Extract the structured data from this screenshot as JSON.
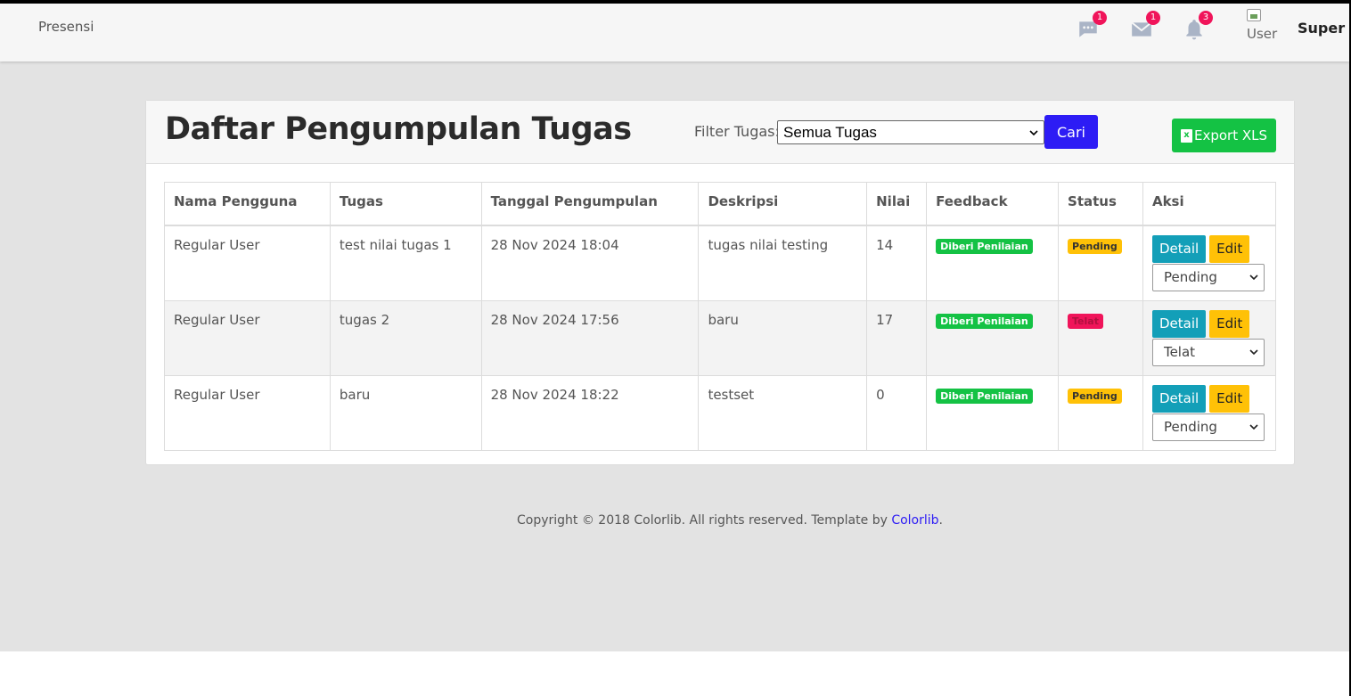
{
  "topbar": {
    "brand": "Presensi",
    "icons": [
      {
        "name": "chat-icon",
        "count": "1"
      },
      {
        "name": "mail-icon",
        "count": "1"
      },
      {
        "name": "bell-icon",
        "count": "3"
      }
    ],
    "avatar_alt": "User",
    "username": "Super A"
  },
  "card": {
    "title": "Daftar Pengumpulan Tugas",
    "filter_label": "Filter Tugas:",
    "filter_value": "Semua Tugas",
    "search_label": "Cari",
    "export_label": "Export XLS"
  },
  "table": {
    "headers": [
      "Nama Pengguna",
      "Tugas",
      "Tanggal Pengumpulan",
      "Deskripsi",
      "Nilai",
      "Feedback",
      "Status",
      "Aksi"
    ],
    "rows": [
      {
        "user": "Regular User",
        "task": "test nilai tugas 1",
        "date": "28 Nov 2024 18:04",
        "desc": "tugas nilai testing",
        "score": "14",
        "feedback": "Diberi Penilaian",
        "status": "Pending",
        "select": "Pending"
      },
      {
        "user": "Regular User",
        "task": "tugas 2",
        "date": "28 Nov 2024 17:56",
        "desc": "baru",
        "score": "17",
        "feedback": "Diberi Penilaian",
        "status": "Telat",
        "select": "Telat"
      },
      {
        "user": "Regular User",
        "task": "baru",
        "date": "28 Nov 2024 18:22",
        "desc": "testset",
        "score": "0",
        "feedback": "Diberi Penilaian",
        "status": "Pending",
        "select": "Pending"
      }
    ],
    "detail_label": "Detail",
    "edit_label": "Edit"
  },
  "footer": {
    "text": "Copyright © 2018 Colorlib. All rights reserved. Template by ",
    "link": "Colorlib",
    "suffix": "."
  },
  "colors": {
    "primary": "#2d1cf5",
    "success": "#14c244",
    "info": "#139fb8",
    "warning": "#ffc107",
    "danger": "#f0145a"
  }
}
